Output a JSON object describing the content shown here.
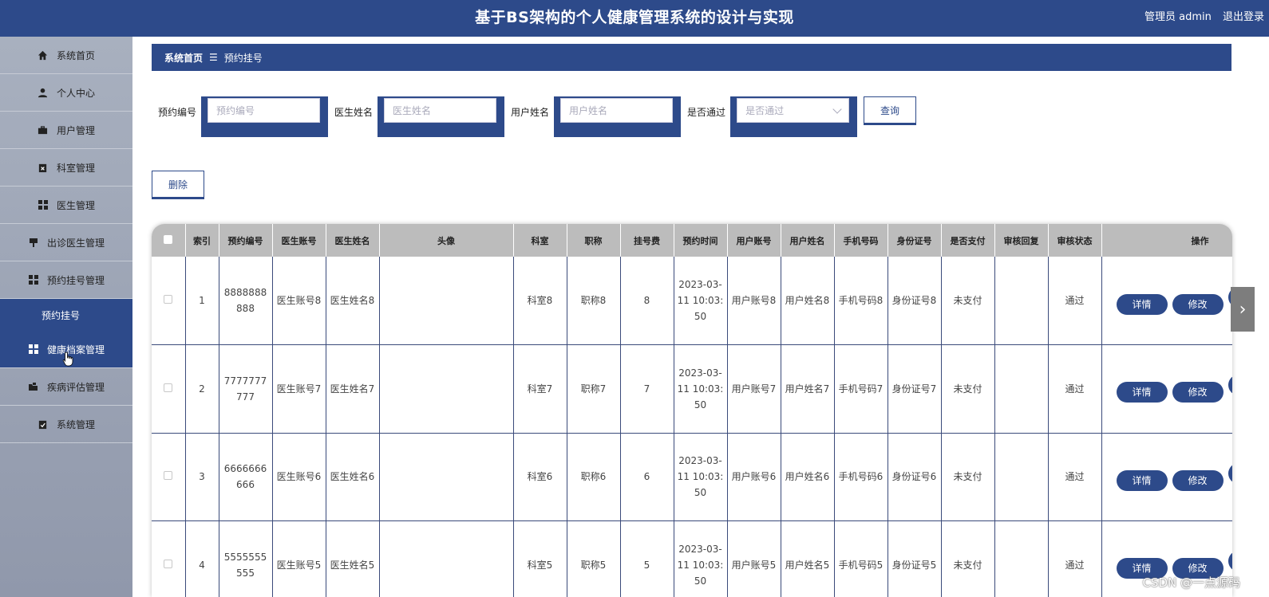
{
  "header": {
    "title": "基于BS架构的个人健康管理系统的设计与实现",
    "user": "管理员 admin",
    "logout": "退出登录"
  },
  "sidebar": {
    "items": [
      {
        "label": "系统首页",
        "icon": "home-icon"
      },
      {
        "label": "个人中心",
        "icon": "person-icon"
      },
      {
        "label": "用户管理",
        "icon": "briefcase-icon"
      },
      {
        "label": "科室管理",
        "icon": "clipboard-x-icon"
      },
      {
        "label": "医生管理",
        "icon": "grid-icon"
      },
      {
        "label": "出诊医生管理",
        "icon": "stamp-icon"
      },
      {
        "label": "预约挂号管理",
        "icon": "grid-icon"
      }
    ],
    "submenu": {
      "label": "预约挂号"
    },
    "items2": [
      {
        "label": "健康档案管理",
        "icon": "grid-icon"
      },
      {
        "label": "疾病评估管理",
        "icon": "folder-icon"
      },
      {
        "label": "系统管理",
        "icon": "clipboard-check-icon"
      }
    ]
  },
  "breadcrumb": {
    "home": "系统首页",
    "separator": "☰",
    "current": "预约挂号"
  },
  "search": {
    "fields": [
      {
        "label": "预约编号",
        "placeholder": "预约编号"
      },
      {
        "label": "医生姓名",
        "placeholder": "医生姓名"
      },
      {
        "label": "用户姓名",
        "placeholder": "用户姓名"
      },
      {
        "label": "是否通过",
        "placeholder": "是否通过"
      }
    ],
    "query_label": "查询"
  },
  "actions": {
    "delete_label": "删除"
  },
  "table": {
    "columns": [
      "索引",
      "预约编号",
      "医生账号",
      "医生姓名",
      "头像",
      "科室",
      "职称",
      "挂号费",
      "预约时间",
      "用户账号",
      "用户姓名",
      "手机号码",
      "身份证号",
      "是否支付",
      "审核回复",
      "审核状态",
      "操作"
    ],
    "rows": [
      {
        "index": "1",
        "code": "8888888888",
        "doc_account": "医生账号8",
        "doc_name": "医生姓名8",
        "avatar": "",
        "dept": "科室8",
        "title": "职称8",
        "fee": "8",
        "time": "2023-03-11 10:03:50",
        "user_account": "用户账号8",
        "user_name": "用户姓名8",
        "phone": "手机号码8",
        "id_card": "身份证号8",
        "paid": "未支付",
        "reply": "",
        "status": "通过"
      },
      {
        "index": "2",
        "code": "7777777777",
        "doc_account": "医生账号7",
        "doc_name": "医生姓名7",
        "avatar": "",
        "dept": "科室7",
        "title": "职称7",
        "fee": "7",
        "time": "2023-03-11 10:03:50",
        "user_account": "用户账号7",
        "user_name": "用户姓名7",
        "phone": "手机号码7",
        "id_card": "身份证号7",
        "paid": "未支付",
        "reply": "",
        "status": "通过"
      },
      {
        "index": "3",
        "code": "6666666666",
        "doc_account": "医生账号6",
        "doc_name": "医生姓名6",
        "avatar": "",
        "dept": "科室6",
        "title": "职称6",
        "fee": "6",
        "time": "2023-03-11 10:03:50",
        "user_account": "用户账号6",
        "user_name": "用户姓名6",
        "phone": "手机号码6",
        "id_card": "身份证号6",
        "paid": "未支付",
        "reply": "",
        "status": "通过"
      },
      {
        "index": "4",
        "code": "5555555555",
        "doc_account": "医生账号5",
        "doc_name": "医生姓名5",
        "avatar": "",
        "dept": "科室5",
        "title": "职称5",
        "fee": "5",
        "time": "2023-03-11 10:03:50",
        "user_account": "用户账号5",
        "user_name": "用户姓名5",
        "phone": "手机号码5",
        "id_card": "身份证号5",
        "paid": "未支付",
        "reply": "",
        "status": "通过"
      }
    ],
    "ops": {
      "detail": "详情",
      "edit": "修改"
    }
  },
  "pager": {
    "next_glyph": "›"
  },
  "watermark": "CSDN @一点源码"
}
